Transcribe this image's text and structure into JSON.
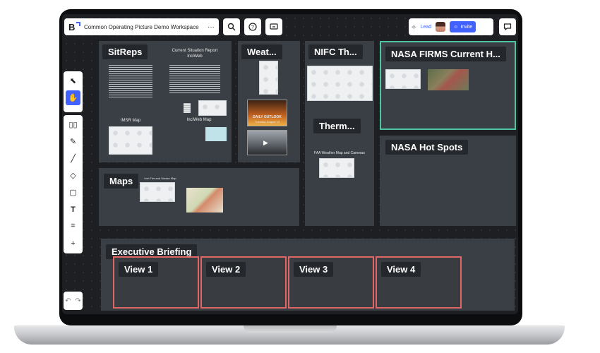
{
  "topbar": {
    "board_title": "Common Operating Picture Demo Workspace",
    "logo": "B",
    "more": "···",
    "lead_label": "Lead",
    "invite_label": "Invite",
    "icons": [
      "search-icon",
      "help-icon",
      "present-icon",
      "lead-icon",
      "chat-icon"
    ]
  },
  "toolbar": {
    "tools": [
      "select-icon",
      "hand-icon",
      "templates-icon",
      "pen-icon",
      "line-icon",
      "shapes-icon",
      "sticky-note-icon",
      "text-icon",
      "frame-icon",
      "add-icon"
    ],
    "undo": "↶",
    "redo": "↷"
  },
  "frames": {
    "sitreps": {
      "label": "SitReps",
      "doc_title": "Current Situation Report\nInciWeb",
      "imsr_map": "IMSR Map",
      "inciweb_map": "InciWeb Map"
    },
    "weather": {
      "label": "Weat...",
      "outlook_title": "DAILY OUTLOOK",
      "outlook_date": "Tuesday, August 10"
    },
    "nifc": {
      "label": "NIFC Th..."
    },
    "therm": {
      "label": "Therm...",
      "caption": "FAA Weather Map and Cameras"
    },
    "firms": {
      "label": "NASA FIRMS Current H..."
    },
    "hotspots": {
      "label": "NASA Hot Spots"
    },
    "maps": {
      "label": "Maps",
      "caption": "Iron Fire and Smoke Map"
    },
    "executive": {
      "label": "Executive Briefing",
      "views": [
        "View 1",
        "View 2",
        "View 3",
        "View 4"
      ]
    }
  },
  "colors": {
    "accent": "#4262ff",
    "selected_frame": "#4ec5a2",
    "view_border": "#e06666",
    "canvas": "#1d1f22",
    "frame_bg": "#3a3f45"
  }
}
